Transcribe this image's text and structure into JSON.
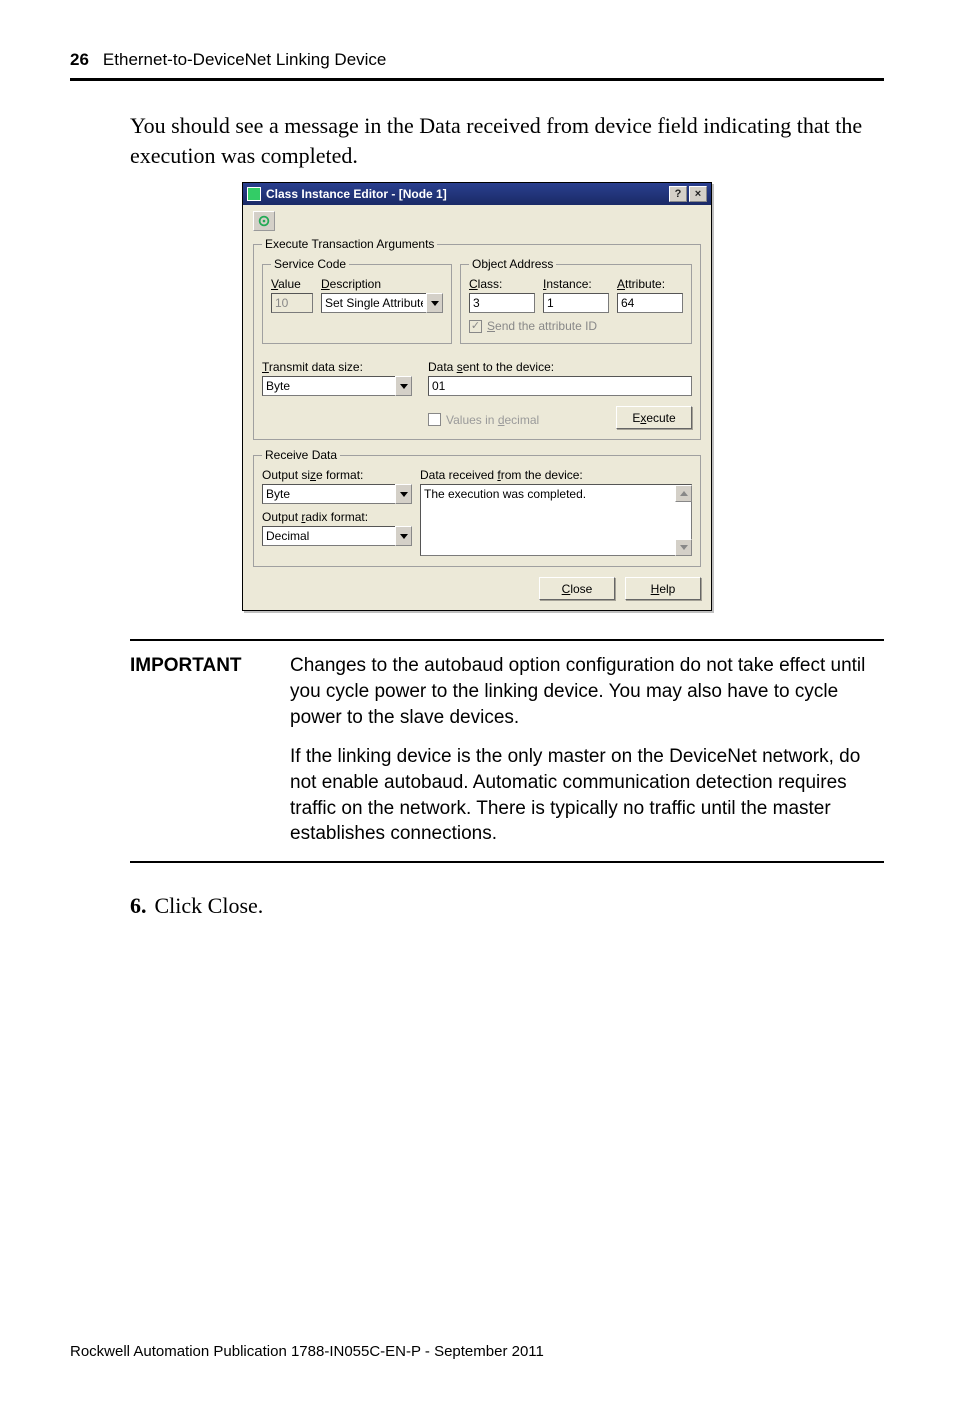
{
  "header": {
    "page_num": "26",
    "title": "Ethernet-to-DeviceNet Linking Device"
  },
  "intro": "You should see a message in the Data received from device field indicating that the execution was completed.",
  "dialog": {
    "title": "Class Instance Editor - [Node 1]",
    "help_glyph": "?",
    "close_glyph": "×",
    "group_exec": "Execute Transaction Arguments",
    "group_svc": "Service Code",
    "svc_value_lbl": "Value",
    "svc_value": "10",
    "svc_desc_lbl": "Description",
    "svc_desc": "Set Single Attribute",
    "group_obj": "Object Address",
    "class_lbl": "Class:",
    "class_val": "3",
    "instance_lbl": "Instance:",
    "instance_val": "1",
    "attr_lbl": "Attribute:",
    "attr_val": "64",
    "send_attr_chk": "Send the attribute ID",
    "transmit_lbl": "Transmit data size:",
    "transmit_val": "Byte",
    "data_sent_lbl": "Data sent to the device:",
    "data_sent_val": "01",
    "values_dec": "Values in decimal",
    "execute_btn": "Execute",
    "group_recv": "Receive Data",
    "out_size_lbl": "Output size format:",
    "out_size_val": "Byte",
    "out_radix_lbl": "Output radix format:",
    "out_radix_val": "Decimal",
    "data_recv_lbl": "Data received from the device:",
    "data_recv_val": "The execution was completed.",
    "close_btn": "Close",
    "help_btn": "Help"
  },
  "important": {
    "label": "IMPORTANT",
    "p1": "Changes to the autobaud option configuration do not take effect until you cycle power to the linking device. You may also have to cycle power to the slave devices.",
    "p2": "If the linking device is the only master on the DeviceNet network, do not enable autobaud. Automatic communication detection requires traffic on the network. There is typically no traffic until the master establishes connections."
  },
  "step": {
    "num": "6.",
    "text": "Click Close."
  },
  "footer": "Rockwell Automation Publication  1788-IN055C-EN-P - September 2011"
}
